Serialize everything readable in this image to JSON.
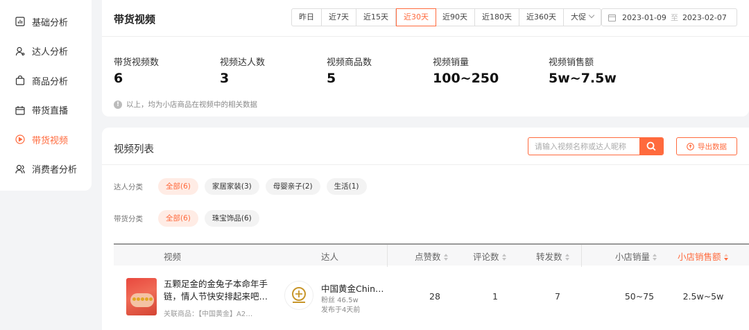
{
  "sidebar": {
    "items": [
      {
        "label": "基础分析",
        "icon": "bar-chart-icon",
        "active": false
      },
      {
        "label": "达人分析",
        "icon": "user-icon",
        "active": false
      },
      {
        "label": "商品分析",
        "icon": "shopping-bag-icon",
        "active": false
      },
      {
        "label": "带货直播",
        "icon": "live-calendar-icon",
        "active": false
      },
      {
        "label": "带货视频",
        "icon": "play-circle-icon",
        "active": true
      },
      {
        "label": "消费者分析",
        "icon": "users-icon",
        "active": false
      }
    ]
  },
  "header": {
    "title": "带货视频",
    "ranges": [
      "昨日",
      "近7天",
      "近15天",
      "近30天",
      "近90天",
      "近180天",
      "近360天",
      "大促"
    ],
    "active_range": "近30天",
    "date_start": "2023-01-09",
    "date_sep": "至",
    "date_end": "2023-02-07"
  },
  "stats": [
    {
      "label": "带货视频数",
      "value": "6"
    },
    {
      "label": "视频达人数",
      "value": "3"
    },
    {
      "label": "视频商品数",
      "value": "5"
    },
    {
      "label": "视频销量",
      "value": "100~250"
    },
    {
      "label": "视频销售额",
      "value": "5w~7.5w"
    }
  ],
  "note": "以上，均为小店商品在视频中的相关数据",
  "list": {
    "title": "视频列表",
    "search_placeholder": "请输入视频名称或达人昵称",
    "export_label": "导出数据",
    "filters": [
      {
        "label": "达人分类",
        "chips": [
          "全部(6)",
          "家居家装(3)",
          "母婴亲子(2)",
          "生活(1)"
        ],
        "active": 0
      },
      {
        "label": "带货分类",
        "chips": [
          "全部(6)",
          "珠宝饰品(6)"
        ],
        "active": 0
      }
    ],
    "columns": {
      "video": "视频",
      "kol": "达人",
      "likes": "点赞数",
      "comments": "评论数",
      "shares": "转发数",
      "sales": "小店销量",
      "revenue": "小店销售额"
    },
    "rows": [
      {
        "title": "五颗足金的金兔子本命年手链，情人节快安排起来吧…",
        "goods": "关联商品：【中国黄金】A2…",
        "kol_name": "中国黄金Chin…",
        "fans": "粉丝 46.5w",
        "published": "发布于4天前",
        "likes": "28",
        "comments": "1",
        "shares": "7",
        "sales": "50~75",
        "revenue": "2.5w~5w"
      }
    ]
  },
  "colors": {
    "accent": "#ff6a3d"
  }
}
